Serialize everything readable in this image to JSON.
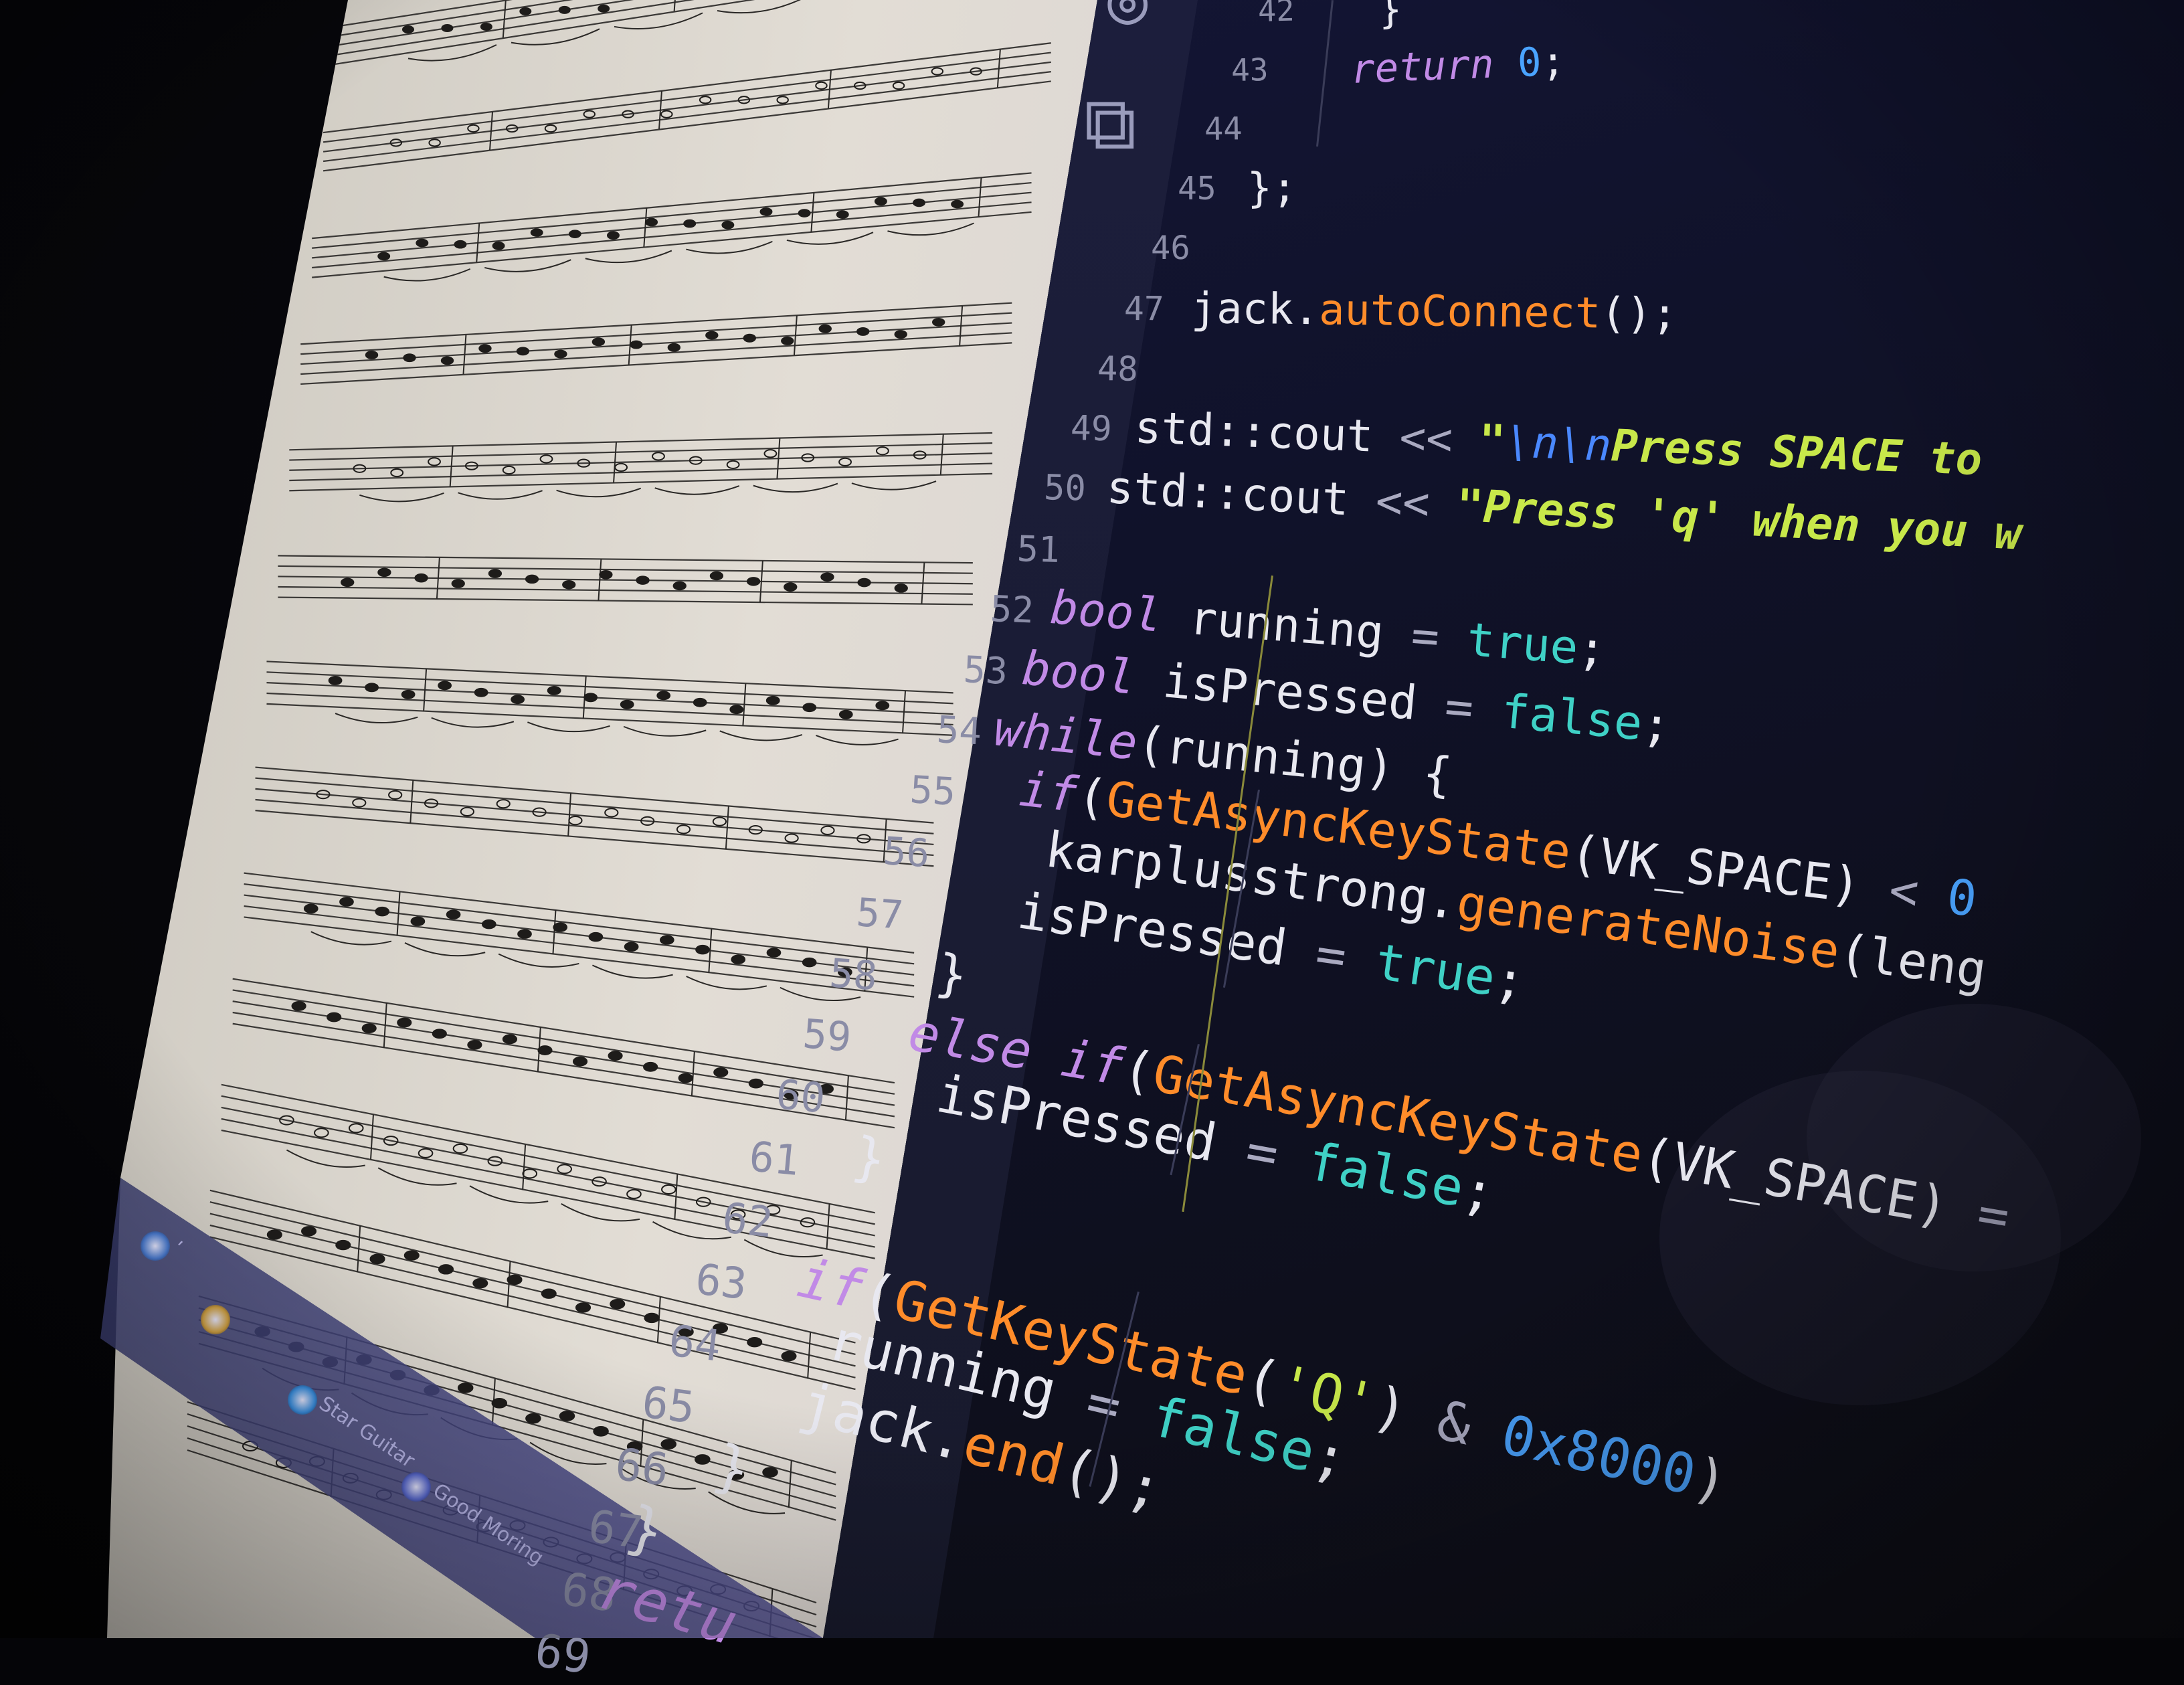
{
  "photo": {
    "subject": "code-editor-and-sheet-music-monitor",
    "colors": {
      "editor_bg": "#10122a",
      "paper": "#e2ddd5",
      "keyword": "#c18ae6",
      "function": "#ff8c2a",
      "type": "#38c9c4",
      "number": "#4aa3ff",
      "string": "#c8e84a",
      "line_number": "#8a8ca6"
    }
  },
  "activity_bar": {
    "icons": [
      "account-icon",
      "extensions-icon"
    ]
  },
  "taskbar": {
    "items": [
      {
        "icon": "search-icon",
        "label": "ʹ"
      },
      {
        "icon": "chrome-icon",
        "label": ""
      },
      {
        "icon": "chrome-icon",
        "label": "Star Guitar"
      },
      {
        "icon": "media-icon",
        "label": "Good Moring"
      }
    ]
  },
  "code": {
    "lines": [
      {
        "n": "42",
        "indent": 2,
        "tokens": [
          {
            "t": "}",
            "c": "w"
          }
        ]
      },
      {
        "n": "43",
        "indent": 2,
        "tokens": [
          {
            "t": "return ",
            "c": "kw"
          },
          {
            "t": "0",
            "c": "nu"
          },
          {
            "t": ";",
            "c": "w"
          }
        ]
      },
      {
        "n": "44",
        "indent": 1,
        "tokens": []
      },
      {
        "n": "45",
        "indent": 1,
        "tokens": [
          {
            "t": "};",
            "c": "w"
          }
        ]
      },
      {
        "n": "46",
        "indent": 1,
        "tokens": []
      },
      {
        "n": "47",
        "indent": 1,
        "tokens": [
          {
            "t": "jack.",
            "c": "w"
          },
          {
            "t": "autoConnect",
            "c": "fn"
          },
          {
            "t": "();",
            "c": "w"
          }
        ]
      },
      {
        "n": "48",
        "indent": 1,
        "tokens": []
      },
      {
        "n": "49",
        "indent": 1,
        "tokens": [
          {
            "t": "std::cout ",
            "c": "w"
          },
          {
            "t": "<< ",
            "c": "op"
          },
          {
            "t": "\"",
            "c": "st"
          },
          {
            "t": "\\n\\n",
            "c": "es"
          },
          {
            "t": "Press SPACE to ",
            "c": "st"
          }
        ]
      },
      {
        "n": "50",
        "indent": 1,
        "tokens": [
          {
            "t": "std::cout ",
            "c": "w"
          },
          {
            "t": "<< ",
            "c": "op"
          },
          {
            "t": "\"Press 'q' when you w",
            "c": "st"
          }
        ]
      },
      {
        "n": "51",
        "indent": 1,
        "tokens": []
      },
      {
        "n": "52",
        "indent": 1,
        "tokens": [
          {
            "t": "bool ",
            "c": "kw"
          },
          {
            "t": "running ",
            "c": "w"
          },
          {
            "t": "= ",
            "c": "op"
          },
          {
            "t": "true",
            "c": "tr"
          },
          {
            "t": ";",
            "c": "w"
          }
        ]
      },
      {
        "n": "53",
        "indent": 1,
        "tokens": [
          {
            "t": "bool ",
            "c": "kw"
          },
          {
            "t": "isPressed ",
            "c": "w"
          },
          {
            "t": "= ",
            "c": "op"
          },
          {
            "t": "false",
            "c": "tr"
          },
          {
            "t": ";",
            "c": "w"
          }
        ]
      },
      {
        "n": "54",
        "indent": 1,
        "tokens": [
          {
            "t": "while",
            "c": "kw"
          },
          {
            "t": "(running) {",
            "c": "w"
          }
        ]
      },
      {
        "n": "55",
        "indent": 2,
        "tokens": [
          {
            "t": "if",
            "c": "kw"
          },
          {
            "t": "(",
            "c": "w"
          },
          {
            "t": "GetAsyncKeyState",
            "c": "fn"
          },
          {
            "t": "(VK_SPACE) ",
            "c": "w"
          },
          {
            "t": "< ",
            "c": "op"
          },
          {
            "t": "0",
            "c": "nu"
          }
        ]
      },
      {
        "n": "56",
        "indent": 3,
        "tokens": [
          {
            "t": "karplusstrong.",
            "c": "w"
          },
          {
            "t": "generateNoise",
            "c": "fn"
          },
          {
            "t": "(leng",
            "c": "w"
          }
        ]
      },
      {
        "n": "57",
        "indent": 3,
        "tokens": [
          {
            "t": "isPressed ",
            "c": "w"
          },
          {
            "t": "= ",
            "c": "op"
          },
          {
            "t": "true",
            "c": "tr"
          },
          {
            "t": ";",
            "c": "w"
          }
        ]
      },
      {
        "n": "58",
        "indent": 2,
        "tokens": [
          {
            "t": "}",
            "c": "w"
          }
        ]
      },
      {
        "n": "59",
        "indent": 2,
        "tokens": [
          {
            "t": "else if",
            "c": "kw"
          },
          {
            "t": "(",
            "c": "w"
          },
          {
            "t": "GetAsyncKeyState",
            "c": "fn"
          },
          {
            "t": "(VK_SPACE) ",
            "c": "w"
          },
          {
            "t": "=",
            "c": "op"
          }
        ]
      },
      {
        "n": "60",
        "indent": 3,
        "tokens": [
          {
            "t": "isPressed ",
            "c": "w"
          },
          {
            "t": "= ",
            "c": "op"
          },
          {
            "t": "false",
            "c": "tr"
          },
          {
            "t": ";",
            "c": "w"
          }
        ]
      },
      {
        "n": "61",
        "indent": 2,
        "tokens": [
          {
            "t": "}",
            "c": "w"
          }
        ]
      },
      {
        "n": "62",
        "indent": 1,
        "tokens": []
      },
      {
        "n": "63",
        "indent": 2,
        "tokens": [
          {
            "t": "if",
            "c": "kw"
          },
          {
            "t": "(",
            "c": "w"
          },
          {
            "t": "GetKeyState",
            "c": "fn"
          },
          {
            "t": "(",
            "c": "w"
          },
          {
            "t": "'Q'",
            "c": "ch"
          },
          {
            "t": ") ",
            "c": "w"
          },
          {
            "t": "& ",
            "c": "op"
          },
          {
            "t": "0x8000",
            "c": "nu"
          },
          {
            "t": ")",
            "c": "w"
          }
        ]
      },
      {
        "n": "64",
        "indent": 3,
        "tokens": [
          {
            "t": "running ",
            "c": "w"
          },
          {
            "t": "= ",
            "c": "op"
          },
          {
            "t": "false",
            "c": "tr"
          },
          {
            "t": ";",
            "c": "w"
          }
        ]
      },
      {
        "n": "65",
        "indent": 3,
        "tokens": [
          {
            "t": "jack.",
            "c": "w"
          },
          {
            "t": "end",
            "c": "fn"
          },
          {
            "t": "();",
            "c": "w"
          }
        ]
      },
      {
        "n": "66",
        "indent": 2,
        "tokens": [
          {
            "t": "}",
            "c": "w"
          }
        ]
      },
      {
        "n": "67",
        "indent": 1,
        "tokens": [
          {
            "t": "}",
            "c": "w"
          }
        ]
      },
      {
        "n": "68",
        "indent": 1,
        "tokens": [
          {
            "t": "retu",
            "c": "kw"
          }
        ]
      },
      {
        "n": "69",
        "indent": 1,
        "tokens": []
      }
    ]
  }
}
